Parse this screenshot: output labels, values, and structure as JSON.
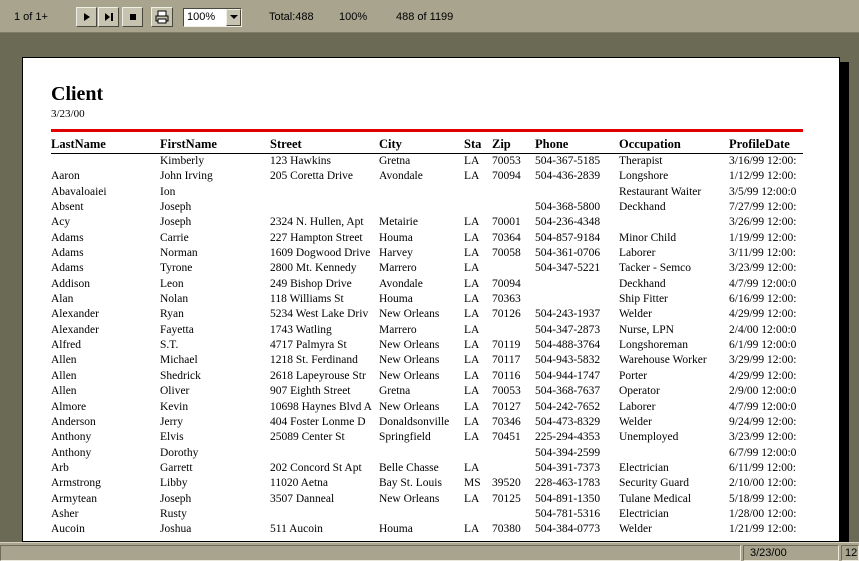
{
  "toolbar": {
    "page_indicator": "1 of 1+",
    "zoom_value": "100%",
    "total": "Total:488",
    "percent": "100%",
    "record_count": "488 of 1199"
  },
  "report": {
    "title": "Client",
    "date": "3/23/00",
    "headers": [
      "LastName",
      "FirstName",
      "Street",
      "City",
      "Sta",
      "Zip",
      "Phone",
      "Occupation",
      "ProfileDate"
    ],
    "rows": [
      [
        "",
        "Kimberly",
        "123 Hawkins",
        "Gretna",
        "LA",
        "70053",
        "504-367-5185",
        "Therapist",
        "3/16/99  12:00:"
      ],
      [
        "Aaron",
        "John Irving",
        "205 Coretta Drive",
        "Avondale",
        "LA",
        "70094",
        "504-436-2839",
        "Longshore",
        "1/12/99  12:00:"
      ],
      [
        "Abavaloaiei",
        "Ion",
        "",
        "",
        "",
        "",
        "",
        "Restaurant Waiter",
        "3/5/99  12:00:0"
      ],
      [
        "Absent",
        "Joseph",
        "",
        "",
        "",
        "",
        "504-368-5800",
        "Deckhand",
        "7/27/99  12:00:"
      ],
      [
        "Acy",
        "Joseph",
        "2324 N. Hullen, Apt",
        "Metairie",
        "LA",
        "70001",
        "504-236-4348",
        "",
        "3/26/99  12:00:"
      ],
      [
        "Adams",
        "Carrie",
        "227 Hampton Street",
        "Houma",
        "LA",
        "70364",
        "504-857-9184",
        "Minor Child",
        "1/19/99  12:00:"
      ],
      [
        "Adams",
        "Norman",
        "1609 Dogwood Drive",
        "Harvey",
        "LA",
        "70058",
        "504-361-0706",
        "Laborer",
        "3/11/99  12:00:"
      ],
      [
        "Adams",
        "Tyrone",
        "2800 Mt. Kennedy",
        "Marrero",
        "LA",
        "",
        "504-347-5221",
        "Tacker - Semco",
        "3/23/99  12:00:"
      ],
      [
        "Addison",
        "Leon",
        "249 Bishop Drive",
        "Avondale",
        "LA",
        "70094",
        "",
        "Deckhand",
        "4/7/99  12:00:0"
      ],
      [
        "Alan",
        "Nolan",
        "118 Williams St",
        "Houma",
        "LA",
        "70363",
        "",
        "Ship Fitter",
        "6/16/99  12:00:"
      ],
      [
        "Alexander",
        "Ryan",
        "5234 West Lake Driv",
        "New Orleans",
        "LA",
        "70126",
        "504-243-1937",
        "Welder",
        "4/29/99  12:00:"
      ],
      [
        "Alexander",
        "Fayetta",
        "1743 Watling",
        "Marrero",
        "LA",
        "",
        "504-347-2873",
        "Nurse, LPN",
        "2/4/00  12:00:0"
      ],
      [
        "Alfred",
        "S.T.",
        "4717 Palmyra St",
        "New Orleans",
        "LA",
        "70119",
        "504-488-3764",
        "Longshoreman",
        "6/1/99  12:00:0"
      ],
      [
        "Allen",
        "Michael",
        "1218 St. Ferdinand",
        "New Orleans",
        "LA",
        "70117",
        "504-943-5832",
        "Warehouse Worker",
        "3/29/99  12:00:"
      ],
      [
        "Allen",
        "Shedrick",
        "2618 Lapeyrouse Str",
        "New Orleans",
        "LA",
        "70116",
        "504-944-1747",
        "Porter",
        "4/29/99  12:00:"
      ],
      [
        "Allen",
        "Oliver",
        "907 Eighth Street",
        "Gretna",
        "LA",
        "70053",
        "504-368-7637",
        "Operator",
        "2/9/00  12:00:0"
      ],
      [
        "Almore",
        "Kevin",
        "10698 Haynes Blvd A",
        "New Orleans",
        "LA",
        "70127",
        "504-242-7652",
        "Laborer",
        "4/7/99  12:00:0"
      ],
      [
        "Anderson",
        "Jerry",
        "404 Foster Lonme D",
        "Donaldsonville",
        "LA",
        "70346",
        "504-473-8329",
        "Welder",
        "9/24/99  12:00:"
      ],
      [
        "Anthony",
        "Elvis",
        "25089 Center St",
        "Springfield",
        "LA",
        "70451",
        "225-294-4353",
        "Unemployed",
        "3/23/99  12:00:"
      ],
      [
        "Anthony",
        "Dorothy",
        "",
        "",
        "",
        "",
        "504-394-2599",
        "",
        "6/7/99  12:00:0"
      ],
      [
        "Arb",
        "Garrett",
        "202 Concord St Apt",
        "Belle Chasse",
        "LA",
        "",
        "504-391-7373",
        "Electrician",
        "6/11/99  12:00:"
      ],
      [
        "Armstrong",
        "Libby",
        "11020 Aetna",
        "Bay St. Louis",
        "MS",
        "39520",
        "228-463-1783",
        "Security Guard",
        "2/10/00  12:00:"
      ],
      [
        "Armytean",
        "Joseph",
        "3507 Danneal",
        "New Orleans",
        "LA",
        "70125",
        "504-891-1350",
        "Tulane Medical",
        "5/18/99  12:00:"
      ],
      [
        "Asher",
        "Rusty",
        "",
        "",
        "",
        "",
        "504-781-5316",
        "Electrician",
        "1/28/00  12:00:"
      ],
      [
        "Aucoin",
        "Joshua",
        "511 Aucoin",
        "Houma",
        "LA",
        "70380",
        "504-384-0773",
        "Welder",
        "1/21/99  12:00:"
      ]
    ]
  },
  "statusbar": {
    "date": "3/23/00",
    "extra": "12"
  },
  "colors": {
    "workspace": "#6b6b55",
    "toolbar": "#a8a48e",
    "rule": "#e00000"
  }
}
